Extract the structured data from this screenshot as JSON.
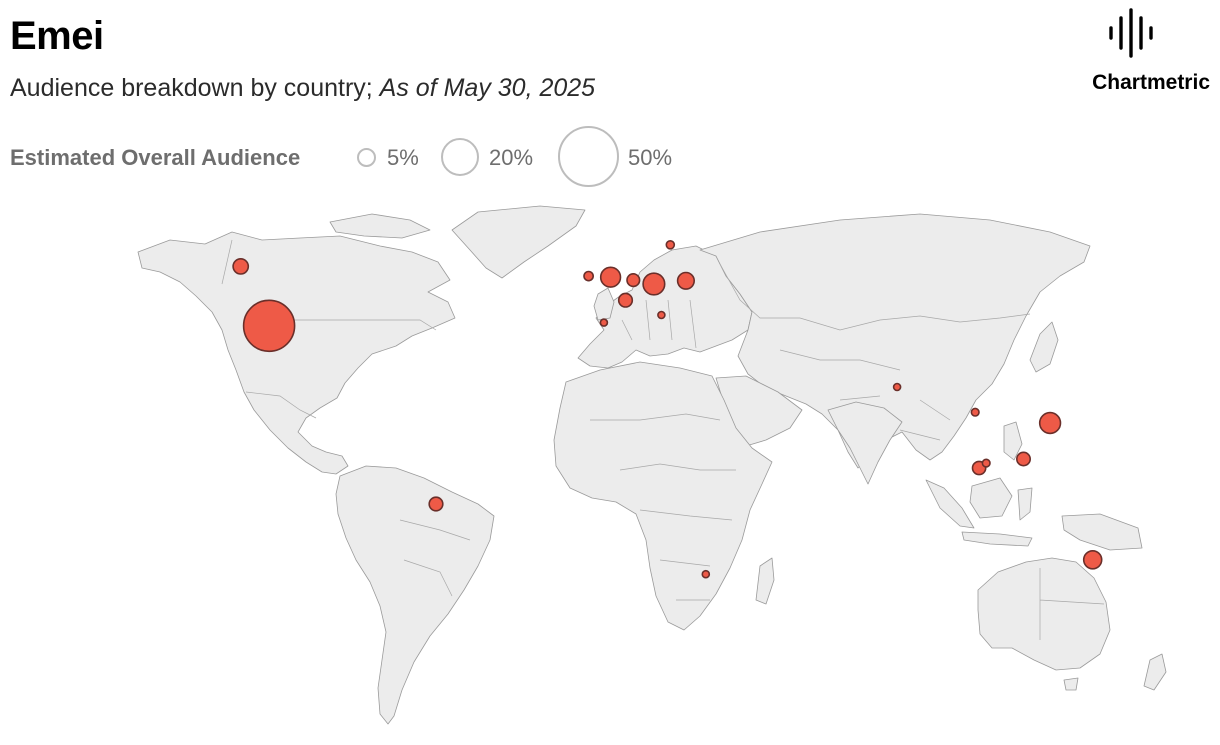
{
  "header": {
    "title": "Emei",
    "subtitle_main": "Audience breakdown by country; ",
    "subtitle_date": "As of May 30, 2025"
  },
  "brand": {
    "name": "Chartmetric",
    "logo_icon": "soundwave-icon"
  },
  "legend": {
    "title": "Estimated Overall Audience",
    "items": [
      {
        "label": "5%",
        "value": 5
      },
      {
        "label": "20%",
        "value": 20
      },
      {
        "label": "50%",
        "value": 50
      }
    ]
  },
  "colors": {
    "land": "#ececec",
    "border": "#9a9a9a",
    "bubble": "#ee5a47",
    "bubble_stroke": "#6a2f2a",
    "legend_stroke": "#bdbdbd"
  },
  "chart_data": {
    "type": "bubble-map",
    "size_measure": "Estimated Overall Audience (%)",
    "points": [
      {
        "lon": -98.0,
        "lat": 39.5,
        "value": 36
      },
      {
        "lon": -106.0,
        "lat": 56.0,
        "value": 3.2
      },
      {
        "lon": -51.0,
        "lat": -10.0,
        "value": 2.6
      },
      {
        "lon": -1.8,
        "lat": 53.0,
        "value": 5.5
      },
      {
        "lon": -8.0,
        "lat": 53.3,
        "value": 1.2
      },
      {
        "lon": 2.4,
        "lat": 46.6,
        "value": 2.6
      },
      {
        "lon": 4.6,
        "lat": 52.2,
        "value": 2.2
      },
      {
        "lon": 10.4,
        "lat": 51.1,
        "value": 6.5
      },
      {
        "lon": 19.4,
        "lat": 52.0,
        "value": 3.8
      },
      {
        "lon": 15.0,
        "lat": 62.0,
        "value": 0.9
      },
      {
        "lon": -3.7,
        "lat": 40.4,
        "value": 0.6
      },
      {
        "lon": 12.5,
        "lat": 42.5,
        "value": 0.6
      },
      {
        "lon": 78.9,
        "lat": 22.5,
        "value": 0.6
      },
      {
        "lon": 100.9,
        "lat": 15.5,
        "value": 0.8
      },
      {
        "lon": 122.0,
        "lat": 12.5,
        "value": 6.0
      },
      {
        "lon": 114.5,
        "lat": 2.5,
        "value": 2.5
      },
      {
        "lon": 102.0,
        "lat": 0.0,
        "value": 2.4
      },
      {
        "lon": 104.0,
        "lat": 1.35,
        "value": 0.8
      },
      {
        "lon": 134.0,
        "lat": -25.5,
        "value": 4.5
      },
      {
        "lon": 25.0,
        "lat": -29.5,
        "value": 0.6
      }
    ]
  }
}
